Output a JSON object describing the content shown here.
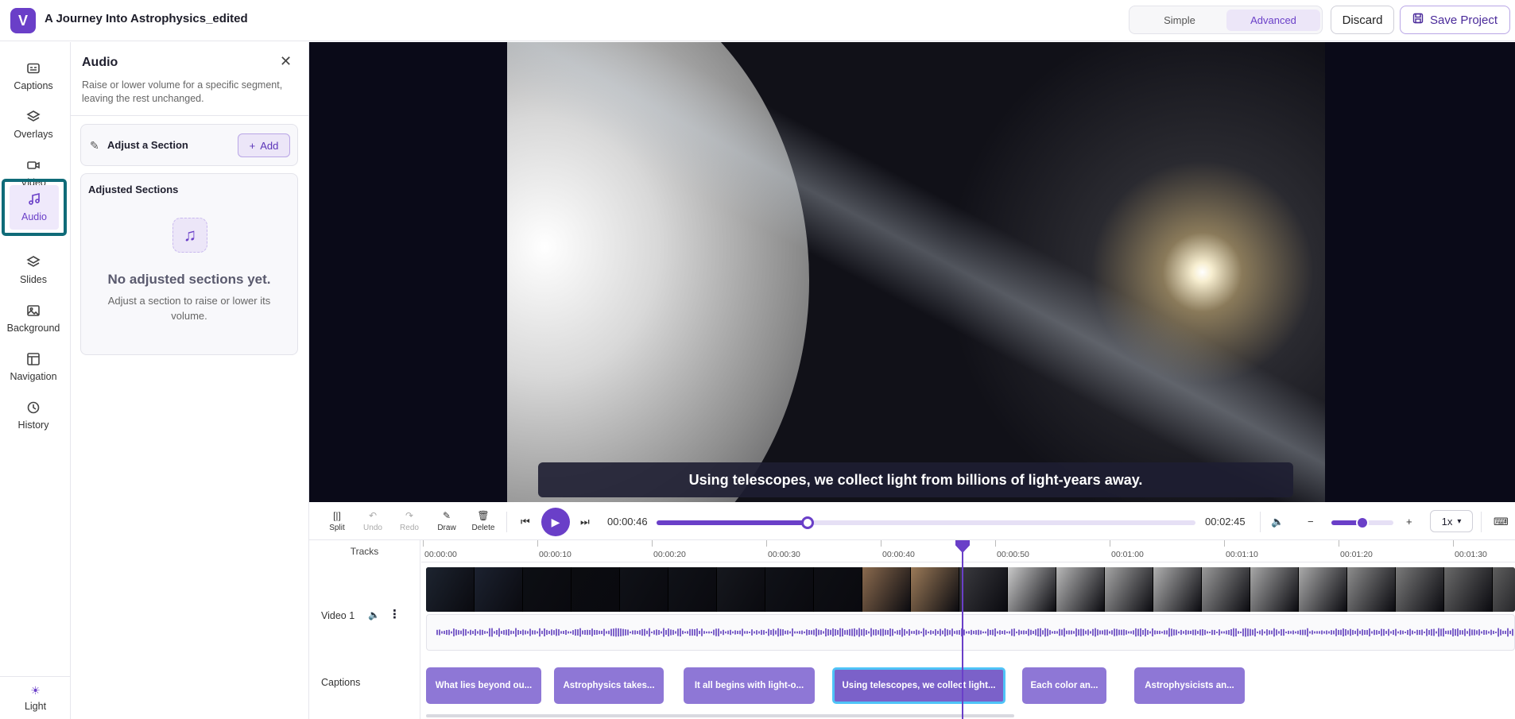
{
  "header": {
    "logo_letter": "V",
    "project_title": "A Journey Into Astrophysics_edited",
    "mode_simple": "Simple",
    "mode_advanced": "Advanced",
    "active_mode": "Advanced",
    "discard_label": "Discard",
    "save_label": "Save Project"
  },
  "sidebar": {
    "items": [
      {
        "label": "Captions",
        "icon": "captions-icon"
      },
      {
        "label": "Overlays",
        "icon": "layers-icon"
      },
      {
        "label": "Video",
        "icon": "video-camera-icon"
      },
      {
        "label": "Audio",
        "icon": "music-note-icon",
        "active": true
      },
      {
        "label": "Slides",
        "icon": "layers-icon"
      },
      {
        "label": "Background",
        "icon": "image-icon"
      },
      {
        "label": "Navigation",
        "icon": "layout-icon"
      },
      {
        "label": "History",
        "icon": "history-icon"
      }
    ],
    "theme_label": "Light"
  },
  "panel": {
    "title": "Audio",
    "description": "Raise or lower volume for a specific segment, leaving the rest unchanged.",
    "adjust_label": "Adjust a Section",
    "add_label": "Add",
    "sections_title": "Adjusted Sections",
    "empty_title": "No adjusted sections yet.",
    "empty_desc": "Adjust a section to raise or lower its volume."
  },
  "player": {
    "caption_text": "Using telescopes, we collect light from billions of light-years away.",
    "current_time": "00:00:46",
    "total_time": "00:02:45",
    "progress_fraction": 0.28,
    "volume_fraction": 0.5,
    "speed": "1x"
  },
  "toolbar": {
    "split": "Split",
    "undo": "Undo",
    "redo": "Redo",
    "draw": "Draw",
    "delete": "Delete"
  },
  "timeline": {
    "tracks_header": "Tracks",
    "ruler": [
      "00:00:00",
      "00:00:10",
      "00:00:20",
      "00:00:30",
      "00:00:40",
      "00:00:50",
      "00:01:00",
      "00:01:10",
      "00:01:20",
      "00:01:30"
    ],
    "video_track_label": "Video 1",
    "captions_track_label": "Captions",
    "caption_clips": [
      "What lies beyond ou...",
      "Astrophysics takes...",
      "It all begins with light-o...",
      "Using telescopes, we collect light...",
      "Each color an...",
      "Astrophysicists an..."
    ],
    "active_clip_index": 3
  },
  "colors": {
    "accent": "#6a3fc8",
    "active_outline": "#0f6b78",
    "clip": "#8e77d6",
    "clip_active_border": "#4fc3f7"
  }
}
